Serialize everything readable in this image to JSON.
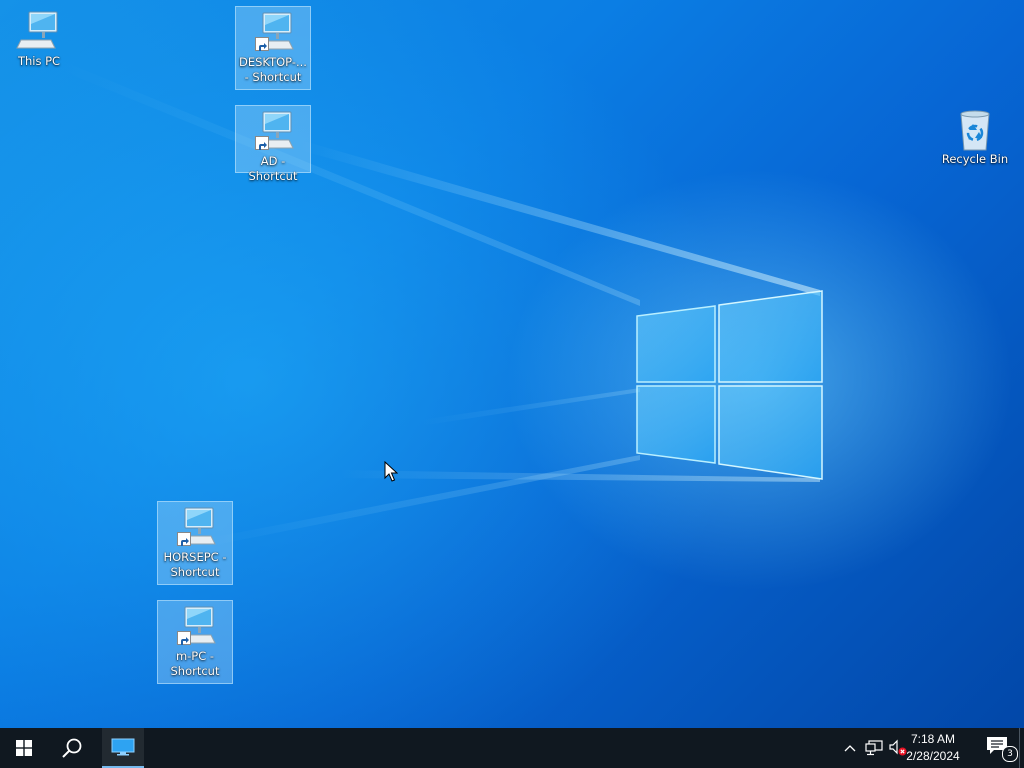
{
  "desktop": {
    "icons": [
      {
        "label": "This PC",
        "icon": "computer-icon",
        "shortcut": false,
        "selected": false
      },
      {
        "label": "DESKTOP-... - Shortcut",
        "icon": "computer-icon",
        "shortcut": true,
        "selected": true
      },
      {
        "label": "AD - Shortcut",
        "icon": "computer-icon",
        "shortcut": true,
        "selected": true
      },
      {
        "label": "Recycle Bin",
        "icon": "recycle-bin-icon",
        "shortcut": false,
        "selected": false
      },
      {
        "label": "HORSEPC - Shortcut",
        "icon": "computer-icon",
        "shortcut": true,
        "selected": true
      },
      {
        "label": "m-PC - Shortcut",
        "icon": "computer-icon",
        "shortcut": true,
        "selected": true
      }
    ]
  },
  "taskbar": {
    "start_icon": "windows-logo-icon",
    "search_icon": "search-icon",
    "pinned_app_icon": "remote-desktop-icon",
    "tray": {
      "overflow_icon": "chevron-up-icon",
      "network_icon": "network-icon",
      "volume_icon": "volume-muted-icon"
    },
    "clock": {
      "time": "7:18 AM",
      "date": "2/28/2024"
    },
    "notifications": {
      "icon": "action-center-icon",
      "count": "3"
    }
  },
  "colors": {
    "taskbar_bg": "#101820",
    "desktop_accent": "#0b7ee4"
  }
}
